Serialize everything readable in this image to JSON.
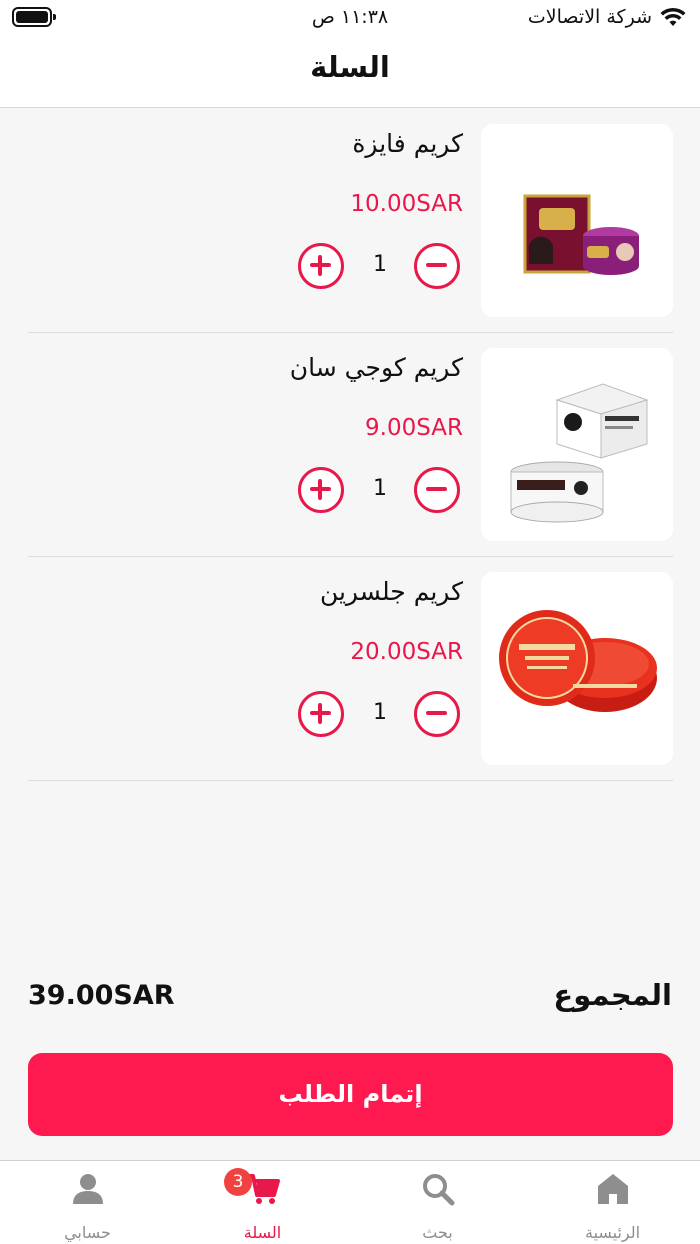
{
  "status_bar": {
    "carrier": "شركة الاتصالات",
    "time": "١١:٣٨ ص"
  },
  "header": {
    "title": "السلة"
  },
  "cart": {
    "items": [
      {
        "name": "كريم فايزة",
        "price": "10.00SAR",
        "quantity": "1"
      },
      {
        "name": "كريم كوجي سان",
        "price": "9.00SAR",
        "quantity": "1"
      },
      {
        "name": "كريم جلسرين",
        "price": "20.00SAR",
        "quantity": "1"
      }
    ],
    "total_label": "المجموع",
    "total_value": "39.00SAR",
    "checkout_label": "إتمام الطلب"
  },
  "tab_bar": {
    "tabs": [
      {
        "label": "الرئيسية",
        "icon": "home-icon"
      },
      {
        "label": "بحث",
        "icon": "search-icon"
      },
      {
        "label": "السلة",
        "icon": "cart-icon",
        "badge": "3",
        "active": true
      },
      {
        "label": "حسابي",
        "icon": "profile-icon"
      }
    ]
  },
  "colors": {
    "accent": "#fe1a4f",
    "price": "#e8184a",
    "inactive_tab": "#8e8e8e",
    "background": "#f6f6f6"
  }
}
